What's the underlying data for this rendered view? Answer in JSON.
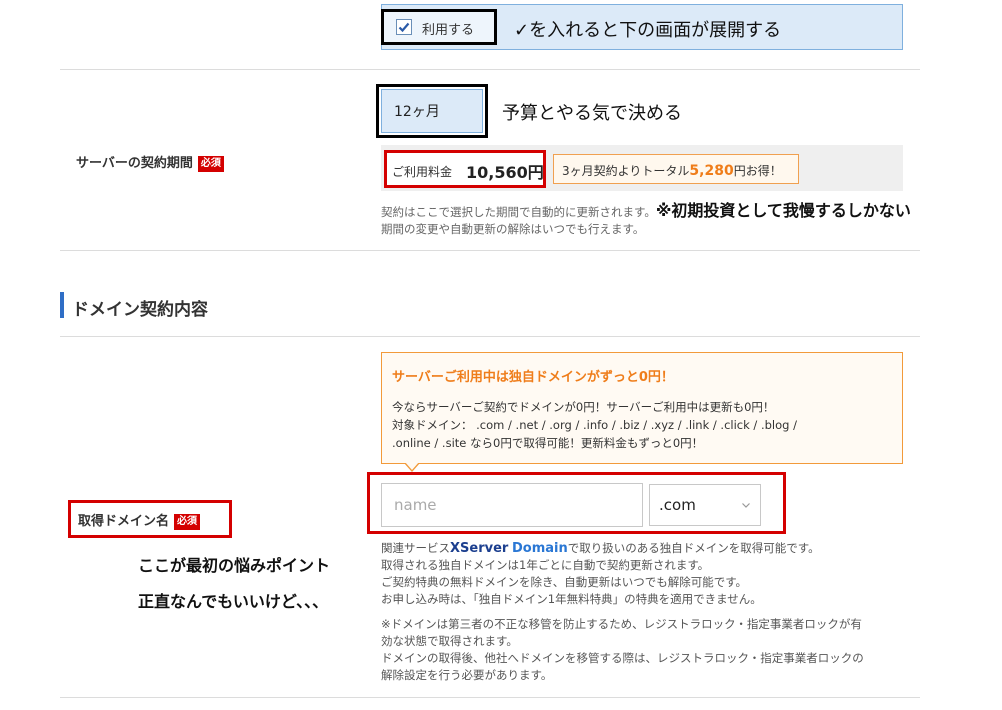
{
  "use_row": {
    "checkbox_checked": true,
    "label": "利用する",
    "annotation": "✓を入れると下の画面が展開する"
  },
  "contract_period": {
    "label": "サーバーの契約期間",
    "required_badge": "必須",
    "selected_value": "12ヶ月",
    "annotation": "予算とやる気で決める",
    "fee_label": "ご利用料金",
    "fee_value": "10,560円",
    "saving_prefix": "3ヶ月契約よりトータル",
    "saving_amount": "5,280",
    "saving_suffix": "円お得！",
    "note_line1": "契約はここで選択した期間で自動的に更新されます。",
    "note_line2": "期間の変更や自動更新の解除はいつでも行えます。",
    "bold_annotation": "※初期投資として我慢するしかない"
  },
  "domain_section": {
    "title": "ドメイン契約内容",
    "promo": {
      "title": "サーバーご利用中は独自ドメインがずっと0円！",
      "line1": "今ならサーバーご契約でドメインが0円！サーバーご利用中は更新も0円！",
      "line2": "対象ドメイン： .com / .net / .org / .info / .biz / .xyz / .link / .click / .blog /",
      "line3": ".online / .site なら0円で取得可能！更新料金もずっと0円！"
    },
    "domain_label": "取得ドメイン名",
    "required_badge": "必須",
    "name_placeholder": "name",
    "tld_value": ".com",
    "related_prefix": "関連サービス",
    "brand_x": "XServer",
    "brand_d": "Domain",
    "related_suffix": "で取り扱いのある独自ドメインを取得可能です。",
    "info_line2": "取得される独自ドメインは1年ごとに自動で契約更新されます。",
    "info_line3": "ご契約特典の無料ドメインを除き、自動更新はいつでも解除可能です。",
    "info_line4": "お申し込み時は、「独自ドメイン1年無料特典」の特典を適用できません。",
    "note_line1": "※ドメインは第三者の不正な移管を防止するため、レジストラロック・指定事業者ロックが有",
    "note_line2": "効な状態で取得されます。",
    "note_line3": "ドメインの取得後、他社へドメインを移管する際は、レジストラロック・指定事業者ロックの",
    "note_line4": "解除設定を行う必要があります。",
    "side_comment1": "ここが最初の悩みポイント",
    "side_comment2": "正直なんでもいいけど、、、"
  }
}
